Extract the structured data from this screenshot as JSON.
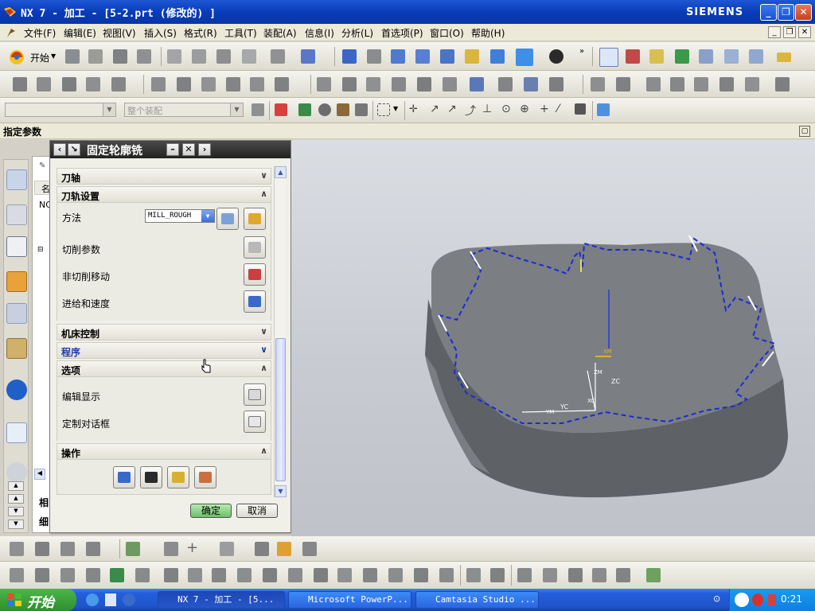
{
  "window": {
    "title": "NX 7 - 加工 - [5-2.prt  (修改的) ]",
    "brand": "SIEMENS"
  },
  "menu": [
    "文件(F)",
    "编辑(E)",
    "视图(V)",
    "插入(S)",
    "格式(R)",
    "工具(T)",
    "装配(A)",
    "信息(I)",
    "分析(L)",
    "首选项(P)",
    "窗口(O)",
    "帮助(H)"
  ],
  "toolbar": {
    "start_label": "开始",
    "filter_placeholder": "",
    "assembly_filter": "整个装配"
  },
  "prompt": "指定参数",
  "dialog": {
    "title": "固定轮廓铣",
    "sections": {
      "tool_axis": "刀轴",
      "path_settings": "刀轨设置",
      "machine_control": "机床控制",
      "program": "程序",
      "options": "选项",
      "actions": "操作"
    },
    "path": {
      "method_label": "方法",
      "method_value": "MILL_ROUGH",
      "cut_params": "切削参数",
      "non_cut_moves": "非切削移动",
      "feeds_speeds": "进给和速度"
    },
    "opts": {
      "edit_display": "编辑显示",
      "custom_dialog": "定制对话框"
    },
    "ok": "确定",
    "cancel": "取消"
  },
  "navigator": {
    "col_header": "名",
    "row1": "NC",
    "tab1": "相",
    "tab2": "细"
  },
  "viewport": {
    "axis_labels": {
      "xc": "XC",
      "yc": "YC",
      "zc": "ZC",
      "xm": "XM",
      "ym": "YM",
      "zm": "ZM"
    }
  },
  "taskbar": {
    "start": "开始",
    "tasks": [
      "NX 7 - 加工 - [5...",
      "Microsoft PowerP...",
      "Camtasia Studio ..."
    ],
    "clock": "0:21"
  },
  "colors": {
    "toolpath": "#1a2bd6",
    "part": "#6f7276",
    "dialog_title": "#2a2a2a",
    "ok_button": "#8fd48a"
  }
}
